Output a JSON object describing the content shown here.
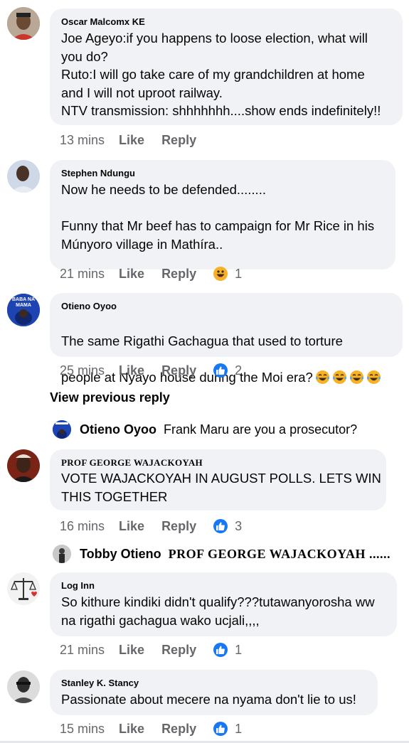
{
  "comments": [
    {
      "author": "Oscar Malcomx KE",
      "text": "Joe Ageyo:if you happens to loose election, what will\nyou do?\nRuto:I will go take care of my grandchildren at home\nand I will not uproot railway.\nNTV transmission: shhhhhhh....show ends indefinitely!!",
      "time": "13 mins",
      "like": "Like",
      "reply": "Reply"
    },
    {
      "author": "Stephen Ndungu",
      "text": "Now he needs to be defended........\n\nFunny that Mr beef has to campaign for Mr Rice in his\nMúnyoro village in Mathíra..",
      "time": "21 mins",
      "like": "Like",
      "reply": "Reply",
      "reaction": "haha-icon",
      "reaction_count": "1"
    },
    {
      "author": "Otieno Oyoo",
      "avatar_text": "BABA NA MAMA",
      "text_line1": "The same Rigathi Gachagua that used to torture",
      "text_line2": "people at Nyayo house during the Moi era?",
      "emoji": "tears-of-joy-icon",
      "time": "25 mins",
      "like": "Like",
      "reply": "Reply",
      "reaction": "like-icon",
      "reaction_count": "2"
    },
    {
      "author": "PROF GEORGE WAJACKOYAH",
      "text": "VOTE WAJACKOYAH IN AUGUST POLLS. LETS WIN\nTHIS TOGETHER",
      "time": "16 mins",
      "like": "Like",
      "reply": "Reply",
      "reaction": "like-icon",
      "reaction_count": "3"
    },
    {
      "author": "Log Inn",
      "text": "So kithure kindiki didn't qualify???tutawanyorosha ww\nna rigathi gachagua wako ucjali,,,,",
      "time": "21 mins",
      "like": "Like",
      "reply": "Reply",
      "reaction": "like-icon",
      "reaction_count": "1"
    },
    {
      "author": "Stanley K. Stancy",
      "text": "Passionate about mecere na nyama don't lie to us!",
      "time": "15 mins",
      "like": "Like",
      "reply": "Reply",
      "reaction": "like-icon",
      "reaction_count": "1"
    }
  ],
  "view_previous_reply": "View previous reply",
  "replies": [
    {
      "author": "Otieno Oyoo",
      "text": "Frank Maru are you a prosecutor?"
    },
    {
      "author": "Tobby Otieno",
      "text": "PROF GEORGE WAJACKOYAH ......"
    }
  ],
  "colors": {
    "bubble": "#f0f2f5",
    "secondary_text": "#65676b",
    "like_blue": "#1877f2",
    "haha_yellow": "#f7b125"
  }
}
